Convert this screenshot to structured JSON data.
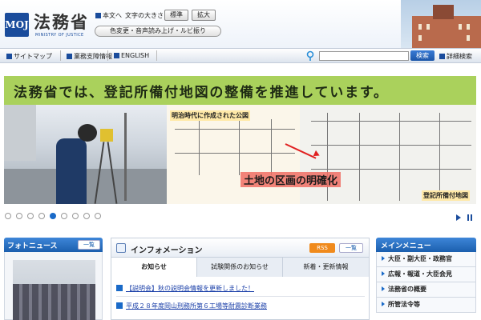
{
  "header": {
    "logo_mark": "MOJ",
    "site_name": "法務省",
    "site_sub": "MINISTRY OF JUSTICE",
    "link_text_only": "本文へ",
    "text_size_label": "文字の大きさ",
    "size_standard": "標準",
    "size_large": "拡大",
    "accessibility_button": "色変更・音声読み上げ・ルビ振り"
  },
  "nav": {
    "sitemap": "サイトマップ",
    "business_support": "業務支障情報",
    "english": "ENGLISH",
    "search_placeholder": "",
    "search_button": "検索",
    "advanced_search": "詳細検索"
  },
  "banner": {
    "headline": "法務省では、登記所備付地図の整備を推進しています。",
    "old_map_label": "明治時代に作成された公図",
    "clarify_label": "土地の区画の明確化",
    "new_map_label": "登記所備付地図"
  },
  "slider": {
    "total_dots": 9,
    "active_index": 4
  },
  "photo_news": {
    "title": "フォトニュース",
    "list_button": "一覧"
  },
  "information": {
    "title": "インフォメーション",
    "rss_button": "RSS",
    "list_button": "一覧",
    "tabs": [
      {
        "label": "お知らせ",
        "active": true
      },
      {
        "label": "試験関係のお知らせ",
        "active": false
      },
      {
        "label": "新着・更新情報",
        "active": false
      }
    ],
    "items": [
      "【説明会】秋の説明会情報を更新しました！",
      "平成２８年度岡山刑務所第６工場等耐震診断業務"
    ]
  },
  "main_menu": {
    "title": "メインメニュー",
    "items": [
      "大臣・副大臣・政務官",
      "広報・報道・大臣会見",
      "法務省の概要",
      "所管法令等"
    ]
  },
  "colors": {
    "brand_blue": "#1a4c9c",
    "banner_green": "#aad15c",
    "rss_orange": "#f08a1c"
  }
}
